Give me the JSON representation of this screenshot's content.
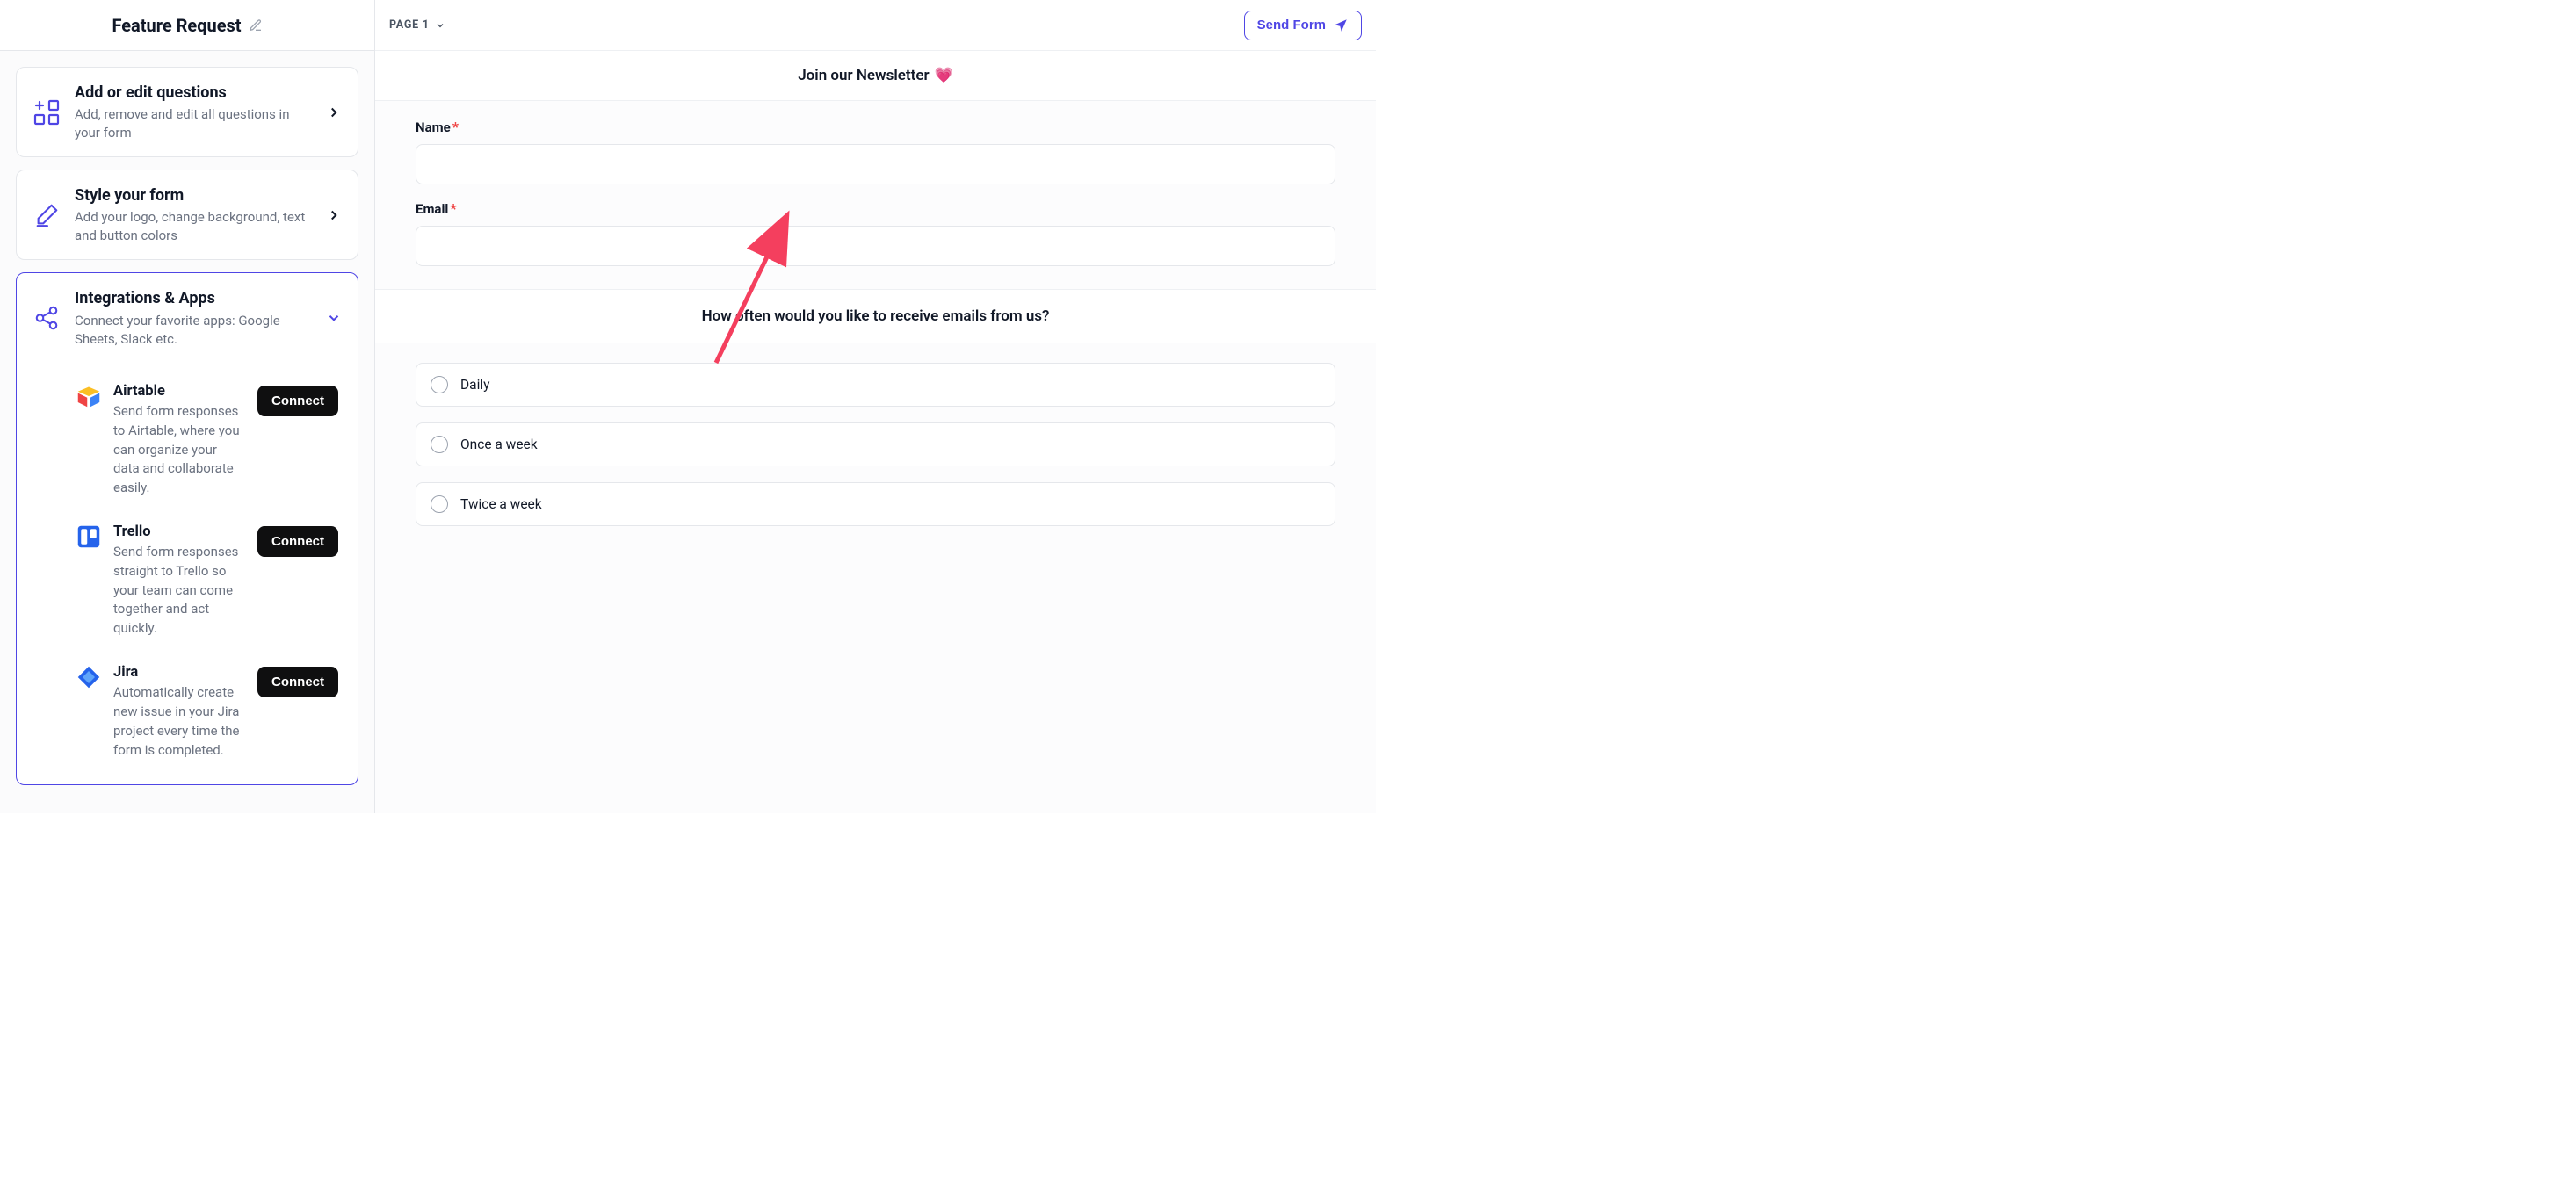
{
  "left": {
    "title": "Feature Request",
    "cards": {
      "questions": {
        "title": "Add or edit questions",
        "subtitle": "Add, remove and edit all questions in your form"
      },
      "style": {
        "title": "Style your form",
        "subtitle": "Add your logo, change background, text and button colors"
      },
      "integrations": {
        "title": "Integrations & Apps",
        "subtitle": "Connect your favorite apps: Google Sheets, Slack etc."
      }
    },
    "integrations": [
      {
        "name": "Airtable",
        "desc": "Send form responses to Airtable, where you can organize your data and collaborate easily.",
        "cta": "Connect"
      },
      {
        "name": "Trello",
        "desc": "Send form responses straight to Trello so your team can come together and act quickly.",
        "cta": "Connect"
      },
      {
        "name": "Jira",
        "desc": "Automatically create new issue in your Jira project every time the form is completed.",
        "cta": "Connect"
      }
    ]
  },
  "right": {
    "page_label": "PAGE 1",
    "send_label": "Send Form",
    "newsletter_title": "Join our Newsletter",
    "fields": {
      "name": {
        "label": "Name"
      },
      "email": {
        "label": "Email"
      }
    },
    "question_title": "How often would you like to receive emails from us?",
    "options": [
      "Daily",
      "Once a week",
      "Twice a week"
    ]
  }
}
